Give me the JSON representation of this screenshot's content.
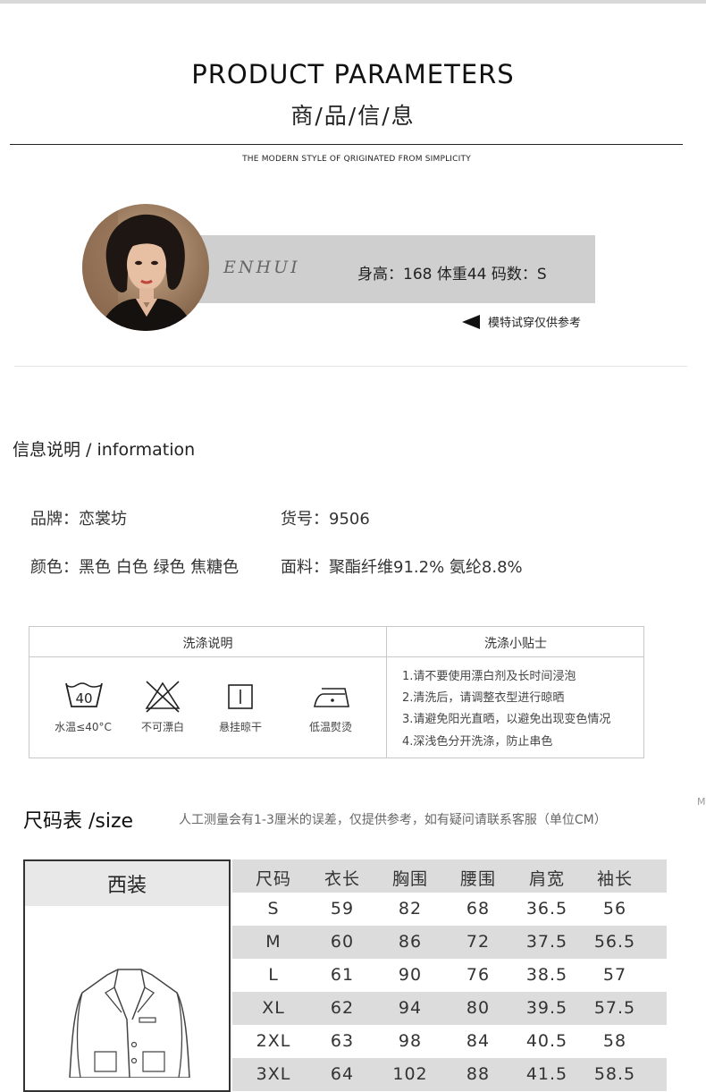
{
  "header": {
    "title_en": "PRODUCT PARAMETERS",
    "title_cn": "商/品/信/息",
    "subtitle": "THE MODERN STYLE OF QRIGINATED FROM SIMPLICITY"
  },
  "model": {
    "signature": "ENHUI",
    "info": "身高：168  体重44  码数：S",
    "note": "模特试穿仅供参考"
  },
  "info": {
    "heading": "信息说明 / information",
    "brand": "品牌：恋裳坊",
    "item_no": "货号：9506",
    "colors": "颜色：黑色 白色 绿色 焦糖色",
    "fabric": "面料：聚酯纤维91.2% 氨纶8.8%"
  },
  "wash": {
    "left_header": "洗涤说明",
    "right_header": "洗涤小贴士",
    "icons": [
      {
        "name": "wash-40-icon",
        "label": "水温≤40°C",
        "symbol": "40"
      },
      {
        "name": "no-bleach-icon",
        "label": "不可漂白"
      },
      {
        "name": "hang-dry-icon",
        "label": "悬挂晾干"
      },
      {
        "name": "low-iron-icon",
        "label": "低温熨烫"
      }
    ],
    "tips": [
      "1.请不要使用漂白剂及长时间浸泡",
      "2.清洗后，请调整衣型进行晾晒",
      "3.请避免阳光直晒，以避免出现变色情况",
      "4.深浅色分开洗涤，防止串色"
    ]
  },
  "size": {
    "heading": "尺码表 /size",
    "note": "人工测量会有1-3厘米的误差，仅提供参考，如有疑问请联系客服（单位CM）",
    "side_mark": "M",
    "garment": "西装",
    "columns": [
      "尺码",
      "衣长",
      "胸围",
      "腰围",
      "肩宽",
      "袖长"
    ],
    "rows": [
      [
        "S",
        "59",
        "82",
        "68",
        "36.5",
        "56"
      ],
      [
        "M",
        "60",
        "86",
        "72",
        "37.5",
        "56.5"
      ],
      [
        "L",
        "61",
        "90",
        "76",
        "38.5",
        "57"
      ],
      [
        "XL",
        "62",
        "94",
        "80",
        "39.5",
        "57.5"
      ],
      [
        "2XL",
        "63",
        "98",
        "84",
        "40.5",
        "58"
      ],
      [
        "3XL",
        "64",
        "102",
        "88",
        "41.5",
        "58.5"
      ]
    ]
  },
  "colors": {
    "band": "#cfcfcf",
    "row_alt": "#dcdcdc",
    "border": "#c8c8c8"
  }
}
